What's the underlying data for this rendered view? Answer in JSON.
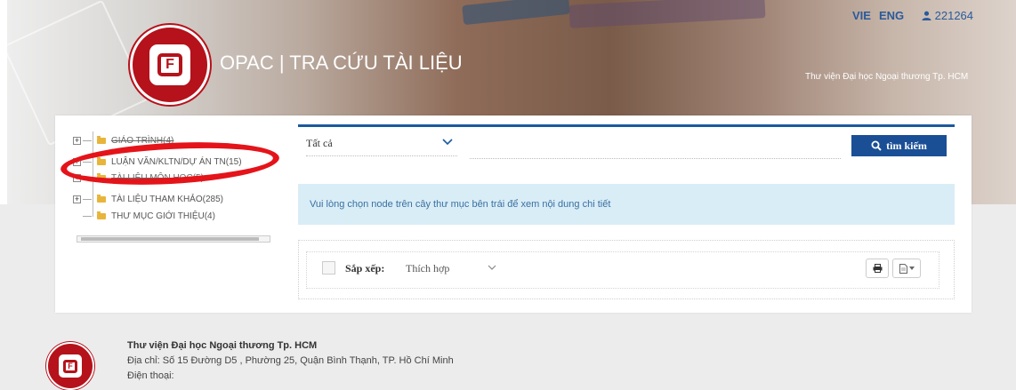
{
  "header": {
    "title": "OPAC | TRA CỨU TÀI LIỆU",
    "library_name": "Thư viện Đại học Ngoại thương Tp. HCM",
    "languages": [
      "VIE",
      "ENG"
    ],
    "user_id": "221264",
    "icons": [
      "university-logo",
      "user-icon"
    ]
  },
  "tree": {
    "items": [
      {
        "label": "GIÁO TRÌNH(4)",
        "expandable": true,
        "struck": true
      },
      {
        "label": "LUẬN VĂN/KLTN/DỰ ÁN TN(15)",
        "expandable": true,
        "struck": false,
        "highlighted": true
      },
      {
        "label": "TÀI LIỆU MÔN HỌC(5)",
        "expandable": true,
        "struck": true
      },
      {
        "label": "TÀI LIỆU THAM KHẢO(285)",
        "expandable": true,
        "struck": false
      },
      {
        "label": "THƯ MỤC GIỚI THIỆU(4)",
        "expandable": false,
        "struck": false
      }
    ],
    "icons": [
      "folder-icon",
      "expand-icon"
    ]
  },
  "search": {
    "category_selected": "Tất cả",
    "query_value": "",
    "button_label": "tìm kiếm",
    "icons": [
      "search-icon",
      "chevron-down-icon"
    ]
  },
  "info_message": "Vui lòng chọn node trên cây thư mục bên trái để xem nội dung chi tiết",
  "results": {
    "sort_label": "Sắp xếp:",
    "sort_value": "Thích hợp",
    "icons": [
      "print-icon",
      "export-icon"
    ]
  },
  "footer": {
    "name": "Thư viện Đại học Ngoại thương Tp. HCM",
    "address": "Địa chỉ: Số 15 Đường D5 , Phường 25, Quận Bình Thạnh, TP. Hồ Chí Minh",
    "phone": "Điện thoại:"
  },
  "colors": {
    "primary_blue": "#1a4f96",
    "brand_red": "#b5121b",
    "highlight_red": "#e4141a",
    "info_bg": "#d9edf7"
  }
}
